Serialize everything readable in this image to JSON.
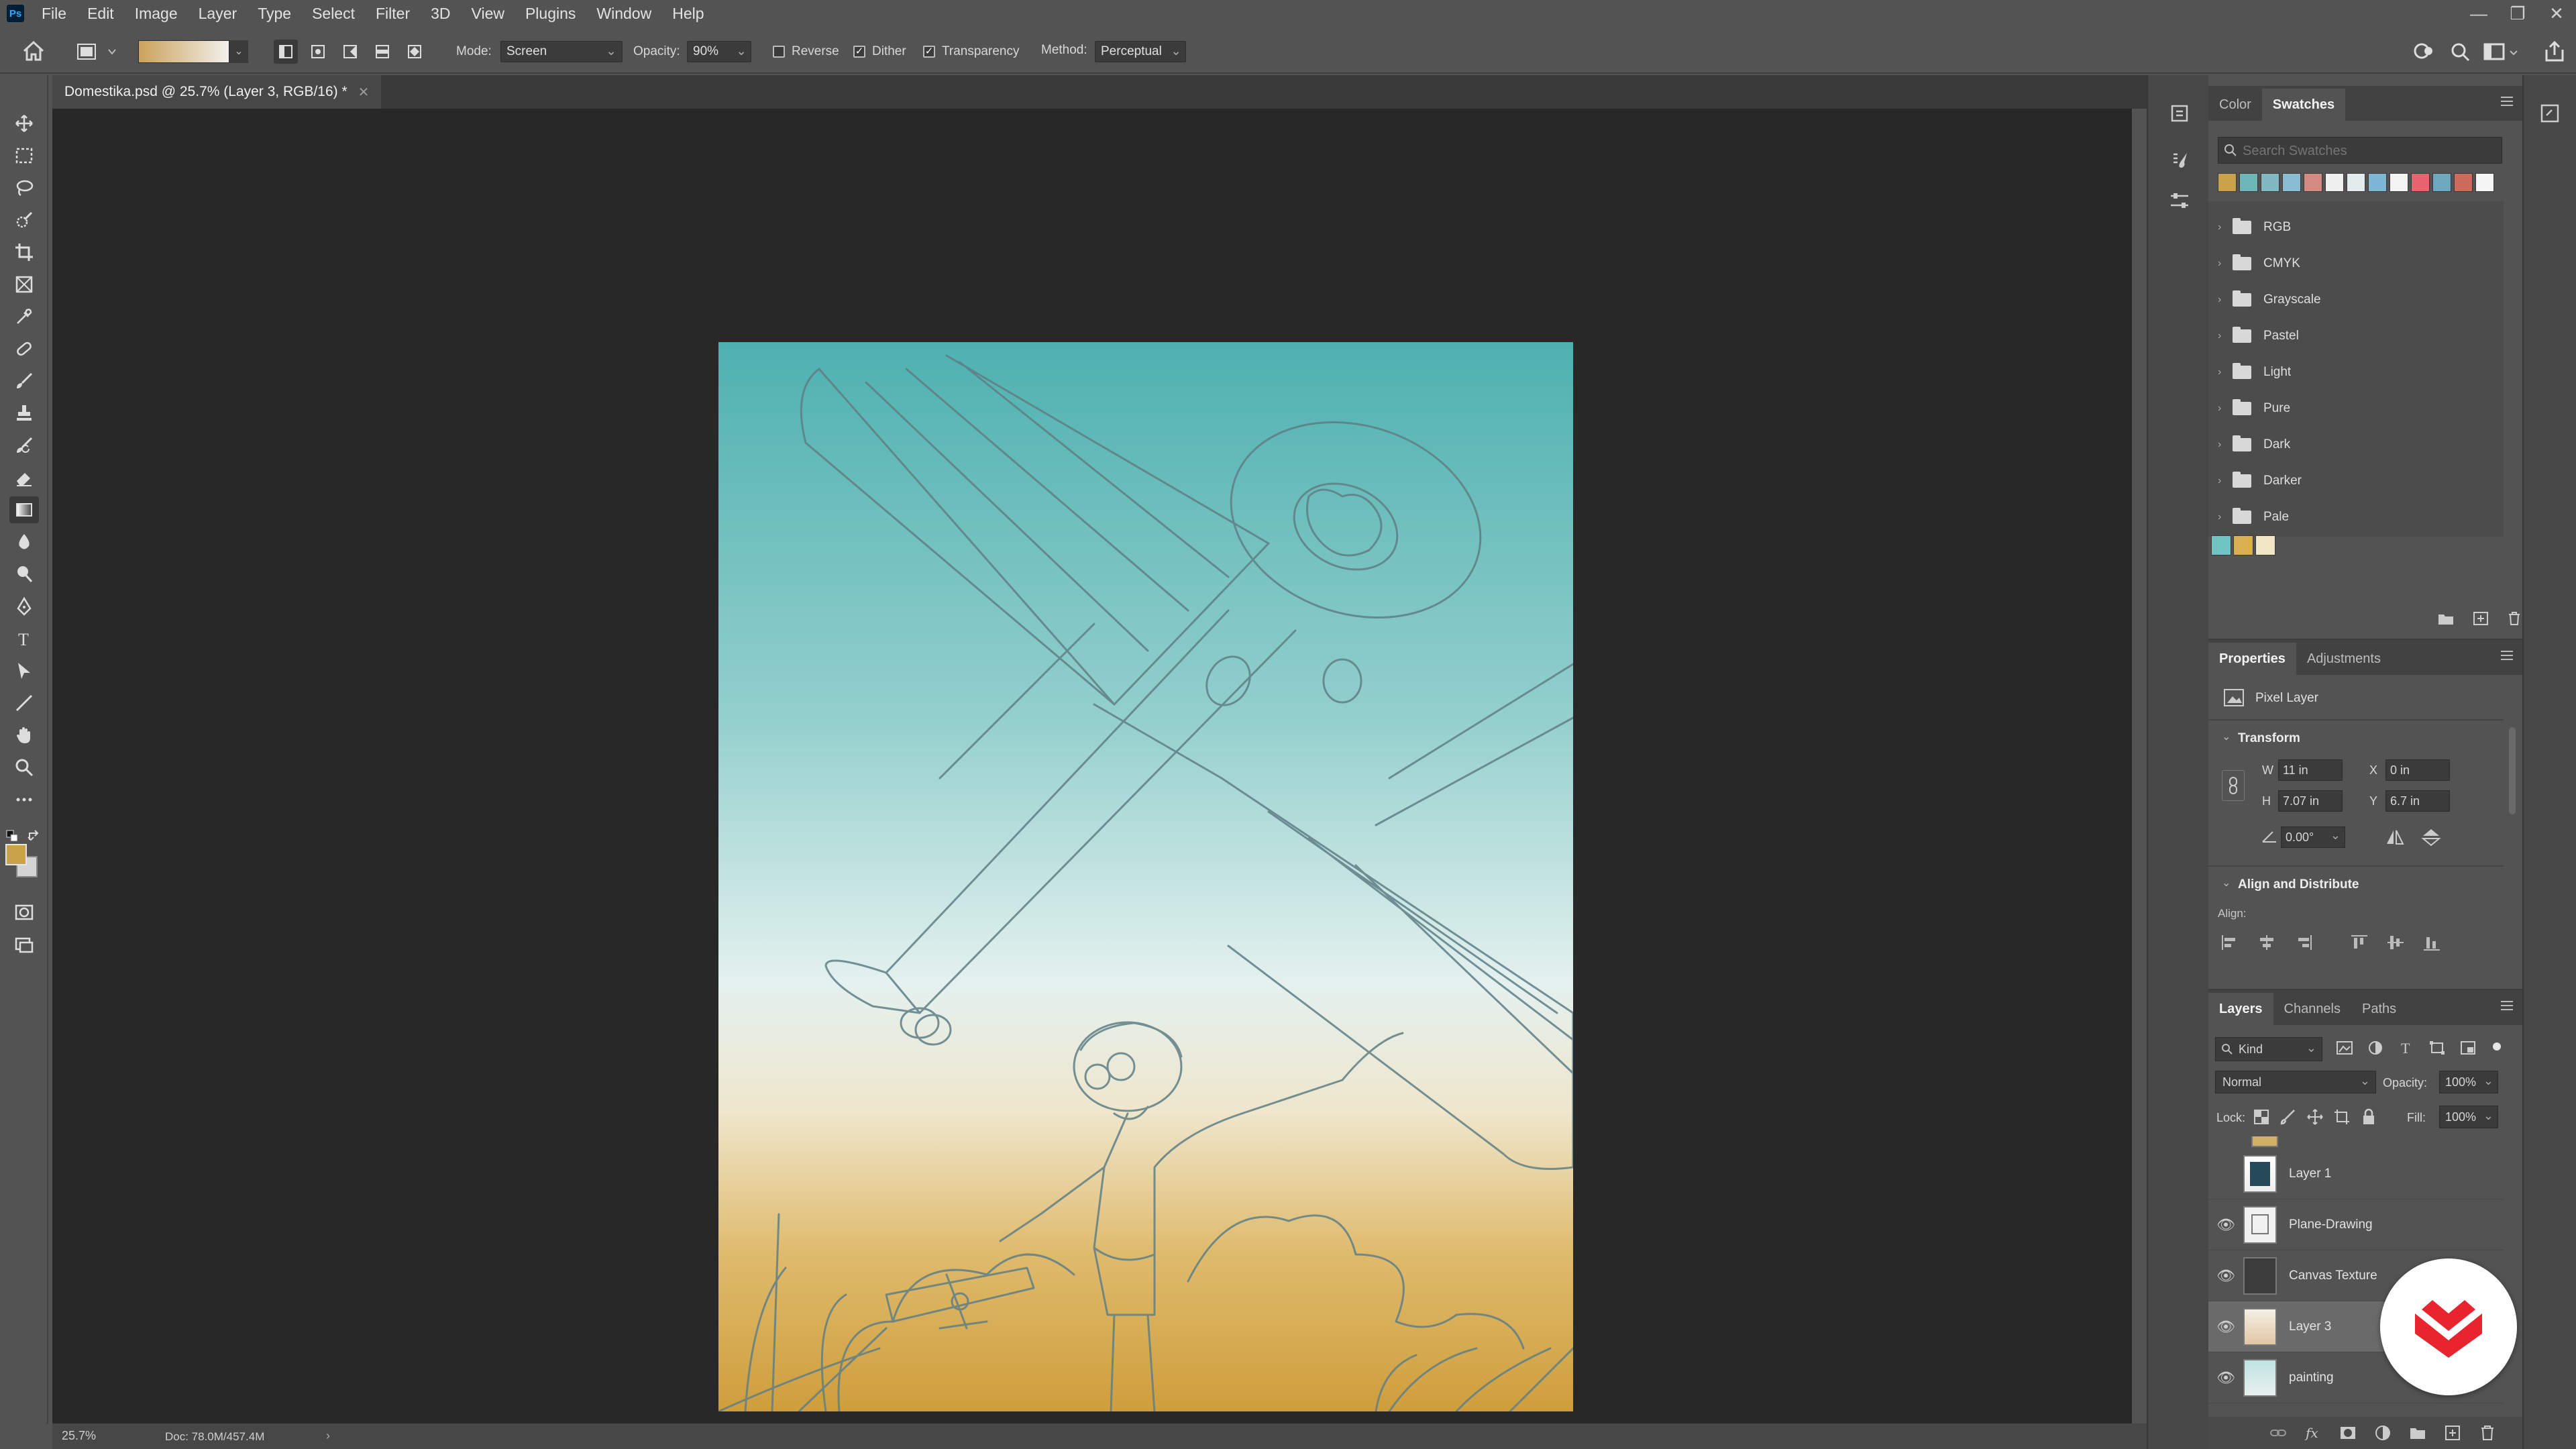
{
  "app": {
    "logo_text": "Ps"
  },
  "menu": [
    "File",
    "Edit",
    "Image",
    "Layer",
    "Type",
    "Select",
    "Filter",
    "3D",
    "View",
    "Plugins",
    "Window",
    "Help"
  ],
  "options_bar": {
    "mode_label": "Mode:",
    "mode_value": "Screen",
    "opacity_label": "Opacity:",
    "opacity_value": "90%",
    "reverse_label": "Reverse",
    "reverse_checked": false,
    "dither_label": "Dither",
    "dither_checked": true,
    "transparency_label": "Transparency",
    "transparency_checked": true,
    "method_label": "Method:",
    "method_value": "Perceptual"
  },
  "document": {
    "tab_title": "Domestika.psd @ 25.7% (Layer 3, RGB/16) *",
    "zoom": "25.7%",
    "doc_size": "Doc: 78.0M/457.4M"
  },
  "colors": {
    "foreground": "#c9a24a",
    "background": "#d4d4d4",
    "sky_top": "#4eb1b0",
    "sky_mid": "#dbeceb",
    "sand_bottom": "#cf9e3c"
  },
  "swatches_panel": {
    "tabs": [
      "Color",
      "Swatches"
    ],
    "active_tab": "Swatches",
    "search_placeholder": "Search Swatches",
    "recent_colors": [
      "#c9a24a",
      "#6fb6b8",
      "#7fb8c0",
      "#8bbdd2",
      "#d28a82",
      "#f0f0f0",
      "#e3ecec",
      "#7cb6d4",
      "#f3f3f3",
      "#e9646e",
      "#6ea9c0",
      "#cc6a5b",
      "#f5f5f5"
    ],
    "folders": [
      "RGB",
      "CMYK",
      "Grayscale",
      "Pastel",
      "Light",
      "Pure",
      "Dark",
      "Darker",
      "Pale"
    ],
    "custom_swatches": [
      "#6fc3c2",
      "#d8b04e",
      "#f1e6c6"
    ]
  },
  "properties_panel": {
    "tabs": [
      "Properties",
      "Adjustments"
    ],
    "active_tab": "Properties",
    "layer_type": "Pixel Layer",
    "transform_title": "Transform",
    "w_label": "W",
    "w_value": "11 in",
    "h_label": "H",
    "h_value": "7.07 in",
    "x_label": "X",
    "x_value": "0 in",
    "y_label": "Y",
    "y_value": "6.7 in",
    "angle_value": "0.00°",
    "align_title": "Align and Distribute",
    "align_label": "Align:"
  },
  "layers_panel": {
    "tabs": [
      "Layers",
      "Channels",
      "Paths"
    ],
    "active_tab": "Layers",
    "filter_kind": "Kind",
    "blend_mode": "Normal",
    "opacity_label": "Opacity:",
    "opacity_value": "100%",
    "lock_label": "Lock:",
    "fill_label": "Fill:",
    "fill_value": "100%",
    "layers": [
      {
        "name": "Layer 1",
        "visible": false,
        "selected": false
      },
      {
        "name": "Plane-Drawing",
        "visible": true,
        "selected": false
      },
      {
        "name": "Canvas Texture",
        "visible": true,
        "selected": false
      },
      {
        "name": "Layer 3",
        "visible": true,
        "selected": true
      },
      {
        "name": "painting",
        "visible": true,
        "selected": false
      }
    ]
  }
}
